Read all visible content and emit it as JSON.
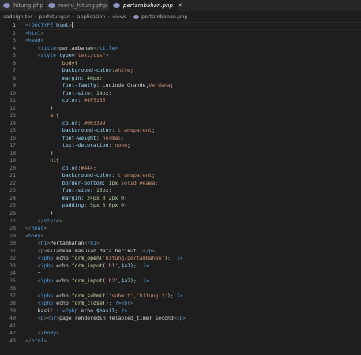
{
  "tabs": [
    {
      "label": "hitung.php",
      "active": false,
      "dirty": false
    },
    {
      "label": "menu_hitung.php",
      "active": false,
      "dirty": true
    },
    {
      "label": "pertambahan.php",
      "active": true,
      "dirty": false
    }
  ],
  "breadcrumb": [
    "codeigniter",
    "perhitungan",
    "application",
    "views",
    "pertambahan.php"
  ],
  "editor": {
    "current_line": 1,
    "lines": [
      {
        "n": "1",
        "indent": 0,
        "tokens": [
          [
            "p",
            "<"
          ],
          [
            "t",
            "!DOCTYPE"
          ],
          [
            "txt",
            " "
          ],
          [
            "a",
            "html"
          ],
          [
            "p",
            ">"
          ]
        ]
      },
      {
        "n": "2",
        "indent": 0,
        "tokens": [
          [
            "p",
            "<"
          ],
          [
            "t",
            "html"
          ],
          [
            "p",
            ">"
          ]
        ]
      },
      {
        "n": "3",
        "indent": 0,
        "tokens": [
          [
            "p",
            "<"
          ],
          [
            "t",
            "head"
          ],
          [
            "p",
            ">"
          ]
        ]
      },
      {
        "n": "4",
        "indent": 4,
        "tokens": [
          [
            "p",
            "<"
          ],
          [
            "t",
            "title"
          ],
          [
            "p",
            ">"
          ],
          [
            "txt",
            "pertambahan"
          ],
          [
            "p",
            "</"
          ],
          [
            "t",
            "title"
          ],
          [
            "p",
            ">"
          ]
        ]
      },
      {
        "n": "5",
        "indent": 4,
        "tokens": [
          [
            "p",
            "<"
          ],
          [
            "t",
            "style"
          ],
          [
            "txt",
            " "
          ],
          [
            "a",
            "type"
          ],
          [
            "txt",
            "="
          ],
          [
            "s",
            "\"text/css\""
          ],
          [
            "p",
            ">"
          ]
        ]
      },
      {
        "n": "6",
        "indent": 12,
        "tokens": [
          [
            "sel",
            "body{"
          ]
        ]
      },
      {
        "n": "7",
        "indent": 12,
        "tokens": [
          [
            "prop",
            "background-color"
          ],
          [
            "txt",
            ":"
          ],
          [
            "v",
            "white"
          ],
          [
            "txt",
            ";"
          ]
        ]
      },
      {
        "n": "8",
        "indent": 12,
        "tokens": [
          [
            "prop",
            "margin"
          ],
          [
            "txt",
            ": "
          ],
          [
            "n",
            "40px"
          ],
          [
            "txt",
            ";"
          ]
        ]
      },
      {
        "n": "9",
        "indent": 12,
        "tokens": [
          [
            "prop",
            "font-family"
          ],
          [
            "txt",
            ": Lucinda Grande,"
          ],
          [
            "v",
            "Verdana"
          ],
          [
            "txt",
            ";"
          ]
        ]
      },
      {
        "n": "10",
        "indent": 12,
        "tokens": [
          [
            "prop",
            "font-size"
          ],
          [
            "txt",
            ": "
          ],
          [
            "n",
            "14px"
          ],
          [
            "txt",
            ";"
          ]
        ]
      },
      {
        "n": "11",
        "indent": 12,
        "tokens": [
          [
            "prop",
            "color"
          ],
          [
            "txt",
            ": "
          ],
          [
            "v",
            "#4F5155"
          ],
          [
            "txt",
            ";"
          ]
        ]
      },
      {
        "n": "12",
        "indent": 8,
        "tokens": [
          [
            "txt",
            "}"
          ]
        ]
      },
      {
        "n": "13",
        "indent": 8,
        "tokens": [
          [
            "sel",
            "a"
          ],
          [
            "txt",
            " {"
          ]
        ]
      },
      {
        "n": "14",
        "indent": 12,
        "tokens": [
          [
            "prop",
            "color"
          ],
          [
            "txt",
            ": "
          ],
          [
            "v",
            "#003399"
          ],
          [
            "txt",
            ";"
          ]
        ]
      },
      {
        "n": "15",
        "indent": 12,
        "tokens": [
          [
            "prop",
            "background-color"
          ],
          [
            "txt",
            ": "
          ],
          [
            "v",
            "transparent"
          ],
          [
            "txt",
            ";"
          ]
        ]
      },
      {
        "n": "16",
        "indent": 12,
        "tokens": [
          [
            "prop",
            "font-weight"
          ],
          [
            "txt",
            ": "
          ],
          [
            "v",
            "normal"
          ],
          [
            "txt",
            ";"
          ]
        ]
      },
      {
        "n": "17",
        "indent": 12,
        "tokens": [
          [
            "prop",
            "text-decoration"
          ],
          [
            "txt",
            ": "
          ],
          [
            "v",
            "none"
          ],
          [
            "txt",
            ";"
          ]
        ]
      },
      {
        "n": "18",
        "indent": 8,
        "tokens": [
          [
            "txt",
            "}"
          ]
        ]
      },
      {
        "n": "19",
        "indent": 8,
        "tokens": [
          [
            "sel",
            "h1"
          ],
          [
            "txt",
            "{"
          ]
        ]
      },
      {
        "n": "20",
        "indent": 12,
        "tokens": [
          [
            "prop",
            "color"
          ],
          [
            "txt",
            ":"
          ],
          [
            "v",
            "#444"
          ],
          [
            "txt",
            ";"
          ]
        ]
      },
      {
        "n": "21",
        "indent": 12,
        "tokens": [
          [
            "prop",
            "background-color"
          ],
          [
            "txt",
            ": "
          ],
          [
            "v",
            "transparent"
          ],
          [
            "txt",
            ";"
          ]
        ]
      },
      {
        "n": "22",
        "indent": 12,
        "tokens": [
          [
            "prop",
            "border-bottom"
          ],
          [
            "txt",
            ": "
          ],
          [
            "n",
            "1px"
          ],
          [
            "v",
            " solid #eaea"
          ],
          [
            "txt",
            ";"
          ]
        ]
      },
      {
        "n": "23",
        "indent": 12,
        "tokens": [
          [
            "prop",
            "font-size"
          ],
          [
            "txt",
            ": "
          ],
          [
            "n",
            "16px"
          ],
          [
            "txt",
            ";"
          ]
        ]
      },
      {
        "n": "24",
        "indent": 12,
        "tokens": [
          [
            "prop",
            "margin"
          ],
          [
            "txt",
            ": "
          ],
          [
            "n",
            "24px 0 2px 0"
          ],
          [
            "txt",
            ";"
          ]
        ]
      },
      {
        "n": "25",
        "indent": 12,
        "tokens": [
          [
            "prop",
            "padding"
          ],
          [
            "txt",
            ": "
          ],
          [
            "n",
            "5px 0 6px 0"
          ],
          [
            "txt",
            ";"
          ]
        ]
      },
      {
        "n": "26",
        "indent": 8,
        "tokens": [
          [
            "txt",
            "}"
          ]
        ]
      },
      {
        "n": "27",
        "indent": 4,
        "tokens": [
          [
            "p",
            "</"
          ],
          [
            "t",
            "style"
          ],
          [
            "p",
            ">"
          ]
        ]
      },
      {
        "n": "28",
        "indent": 0,
        "tokens": [
          [
            "p",
            "</"
          ],
          [
            "t",
            "head"
          ],
          [
            "p",
            ">"
          ]
        ]
      },
      {
        "n": "29",
        "indent": 0,
        "tokens": [
          [
            "p",
            "<"
          ],
          [
            "t",
            "body"
          ],
          [
            "p",
            ">"
          ]
        ]
      },
      {
        "n": "30",
        "indent": 4,
        "tokens": [
          [
            "p",
            "<"
          ],
          [
            "t",
            "h1"
          ],
          [
            "p",
            ">"
          ],
          [
            "txt",
            "Pertambahan"
          ],
          [
            "p",
            "</"
          ],
          [
            "t",
            "h1"
          ],
          [
            "p",
            ">"
          ]
        ]
      },
      {
        "n": "31",
        "indent": 4,
        "tokens": [
          [
            "p",
            "<"
          ],
          [
            "t",
            "p"
          ],
          [
            "p",
            ">"
          ],
          [
            "txt",
            "silahkan masukan data berikut :"
          ],
          [
            "p",
            "</"
          ],
          [
            "t",
            "p"
          ],
          [
            "p",
            ">"
          ]
        ]
      },
      {
        "n": "32",
        "indent": 4,
        "tokens": [
          [
            "kw",
            "<?php"
          ],
          [
            "txt",
            " echo "
          ],
          [
            "fn",
            "form_open"
          ],
          [
            "txt",
            "("
          ],
          [
            "s",
            "'hitung/pertambahan'"
          ],
          [
            "txt",
            ");  "
          ],
          [
            "kw",
            "?>"
          ]
        ]
      },
      {
        "n": "33",
        "indent": 4,
        "tokens": [
          [
            "kw",
            "<?php"
          ],
          [
            "txt",
            " echo "
          ],
          [
            "fn",
            "form_input"
          ],
          [
            "txt",
            "("
          ],
          [
            "s",
            "'b1'"
          ],
          [
            "txt",
            ","
          ],
          [
            "var",
            "$a1"
          ],
          [
            "txt",
            ");  "
          ],
          [
            "kw",
            "?>"
          ]
        ]
      },
      {
        "n": "34",
        "indent": 4,
        "tokens": [
          [
            "txt",
            "+"
          ]
        ]
      },
      {
        "n": "35",
        "indent": 4,
        "tokens": [
          [
            "kw",
            "<?php"
          ],
          [
            "txt",
            " echo "
          ],
          [
            "fn",
            "form_input"
          ],
          [
            "txt",
            "("
          ],
          [
            "s",
            "'b2'"
          ],
          [
            "txt",
            ","
          ],
          [
            "var",
            "$a2"
          ],
          [
            "txt",
            ");  "
          ],
          [
            "kw",
            "?>"
          ]
        ]
      },
      {
        "n": "36",
        "indent": 0,
        "tokens": []
      },
      {
        "n": "37",
        "indent": 4,
        "tokens": [
          [
            "kw",
            "<?php"
          ],
          [
            "txt",
            " echo "
          ],
          [
            "fn",
            "form_submit"
          ],
          [
            "txt",
            "("
          ],
          [
            "s",
            "'submit'"
          ],
          [
            "txt",
            ","
          ],
          [
            "s",
            "'hitung!!'"
          ],
          [
            "txt",
            "); "
          ],
          [
            "kw",
            "?>"
          ]
        ]
      },
      {
        "n": "38",
        "indent": 4,
        "tokens": [
          [
            "kw",
            "<?php"
          ],
          [
            "txt",
            " echo "
          ],
          [
            "fn",
            "form_close"
          ],
          [
            "txt",
            "(); "
          ],
          [
            "kw",
            "?>"
          ],
          [
            "p",
            "<"
          ],
          [
            "t",
            "br"
          ],
          [
            "p",
            ">"
          ]
        ]
      },
      {
        "n": "39",
        "indent": 4,
        "tokens": [
          [
            "txt",
            "hasil : "
          ],
          [
            "kw",
            "<?php"
          ],
          [
            "txt",
            " echo "
          ],
          [
            "var",
            "$hasil"
          ],
          [
            "txt",
            "; "
          ],
          [
            "kw",
            "?>"
          ]
        ]
      },
      {
        "n": "40",
        "indent": 4,
        "tokens": [
          [
            "p",
            "<"
          ],
          [
            "t",
            "p"
          ],
          [
            "p",
            ">"
          ],
          [
            "p",
            "<"
          ],
          [
            "t",
            "br"
          ],
          [
            "p",
            ">"
          ],
          [
            "txt",
            "page renderedin {elapsed_time} second"
          ],
          [
            "p",
            "</"
          ],
          [
            "t",
            "p"
          ],
          [
            "p",
            ">"
          ]
        ]
      },
      {
        "n": "41",
        "indent": 0,
        "tokens": []
      },
      {
        "n": "42",
        "indent": 4,
        "tokens": [
          [
            "p",
            "</"
          ],
          [
            "t",
            "body"
          ],
          [
            "p",
            ">"
          ]
        ]
      },
      {
        "n": "43",
        "indent": 0,
        "tokens": [
          [
            "p",
            "</"
          ],
          [
            "t",
            "html"
          ],
          [
            "p",
            ">"
          ]
        ]
      }
    ]
  }
}
